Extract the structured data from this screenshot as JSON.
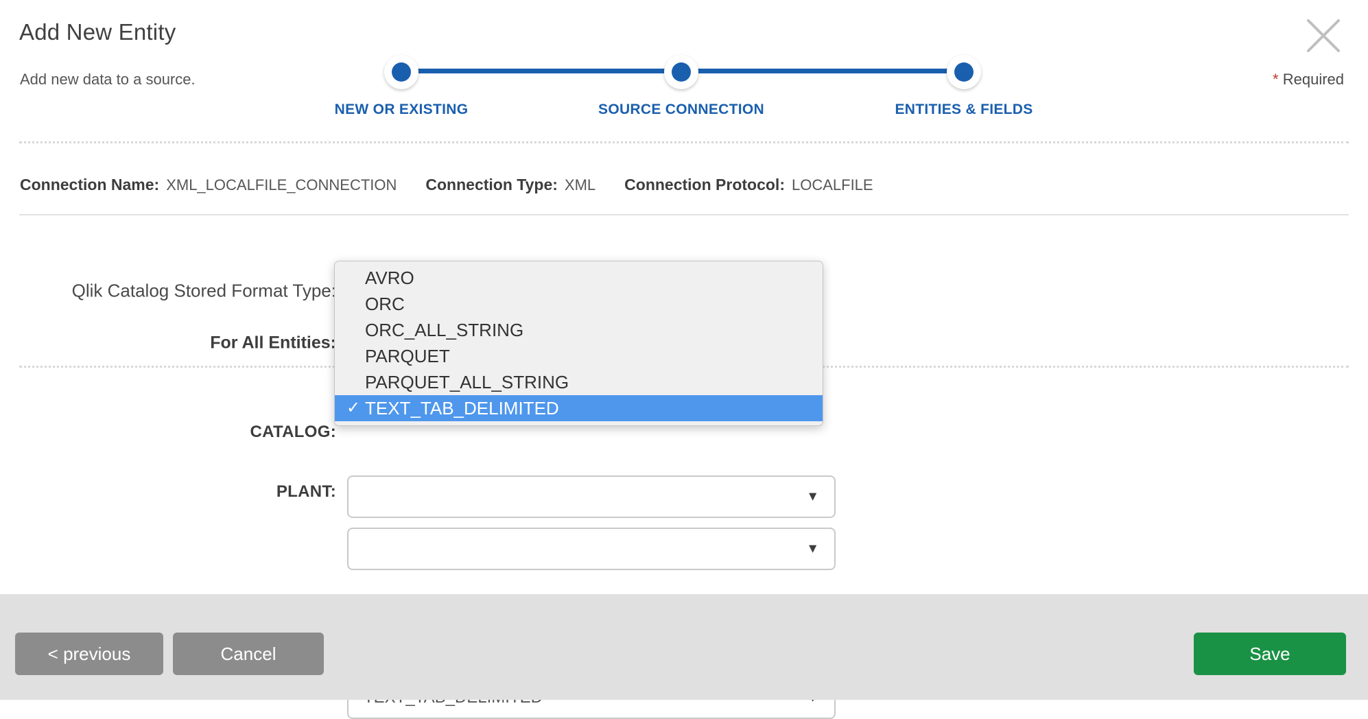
{
  "dialog": {
    "title": "Add New Entity",
    "subtitle": "Add new data to a source.",
    "required_star": "*",
    "required_label": "Required",
    "close_icon": "close-icon"
  },
  "stepper": {
    "steps": [
      {
        "label": "NEW OR EXISTING",
        "state": "complete"
      },
      {
        "label": "SOURCE CONNECTION",
        "state": "complete"
      },
      {
        "label": "ENTITIES & FIELDS",
        "state": "active"
      }
    ],
    "accent_color": "#1a5fae"
  },
  "connection": {
    "name_label": "Connection Name:",
    "name_value": "XML_LOCALFILE_CONNECTION",
    "type_label": "Connection Type:",
    "type_value": "XML",
    "protocol_label": "Connection Protocol:",
    "protocol_value": "LOCALFILE"
  },
  "form": {
    "stored_format_label": "Qlik Catalog Stored Format Type:",
    "stored_format_value": "",
    "for_all_entities_label": "For All Entities:",
    "for_all_entities_value": "",
    "catalog_label": "CATALOG:",
    "catalog_value": "",
    "plant_label": "PLANT:",
    "plant_value": "TEXT_TAB_DELIMITED",
    "dropdown_arrow": "▼"
  },
  "dropdown": {
    "open": true,
    "check_glyph": "✓",
    "highlight_color": "#4f97ec",
    "options": [
      {
        "label": "AVRO",
        "selected": false
      },
      {
        "label": "ORC",
        "selected": false
      },
      {
        "label": "ORC_ALL_STRING",
        "selected": false
      },
      {
        "label": "PARQUET",
        "selected": false
      },
      {
        "label": "PARQUET_ALL_STRING",
        "selected": false
      },
      {
        "label": "TEXT_TAB_DELIMITED",
        "selected": true
      }
    ]
  },
  "footer": {
    "previous_label": "< previous",
    "cancel_label": "Cancel",
    "save_label": "Save",
    "save_color": "#1a9245",
    "grey_color": "#8c8c8c"
  }
}
